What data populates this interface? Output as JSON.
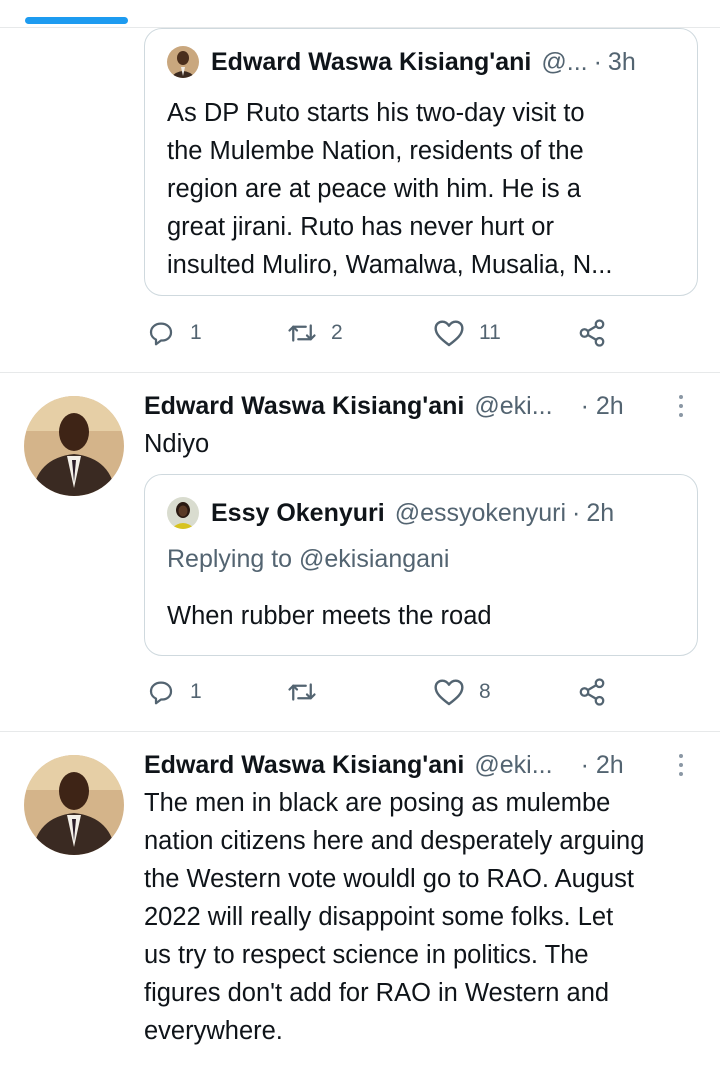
{
  "colors": {
    "accent": "#1d9bf0",
    "text": "#0f1419",
    "muted": "#536471",
    "border": "#cfd9de"
  },
  "first_quote": {
    "name": "Edward Waswa Kisiang'ani",
    "handle": "@...",
    "separator": "·",
    "time": "3h",
    "text_lines": [
      "As DP Ruto starts his two-day visit to",
      "the Mulembe Nation, residents of the",
      "region are at peace with him. He is a",
      "great jirani. Ruto has never hurt or",
      "insulted Muliro, Wamalwa, Musalia, N..."
    ],
    "actions": {
      "reply_count": "1",
      "retweet_count": "2",
      "like_count": "11"
    }
  },
  "tweets": [
    {
      "name": "Edward Waswa Kisiang'ani",
      "handle": "@eki...",
      "time": "· 2h",
      "text": "Ndiyo",
      "quote": {
        "name": "Essy Okenyuri",
        "handle": "@essyokenyuri",
        "separator": "·",
        "time": "2h",
        "replying_to": "Replying to @ekisiangani",
        "text": "When rubber meets the road"
      },
      "actions": {
        "reply_count": "1",
        "retweet_count": "",
        "like_count": "8"
      }
    },
    {
      "name": "Edward Waswa Kisiang'ani",
      "handle": "@eki...",
      "time": "· 2h",
      "text_lines": [
        "The men in black are posing as mulembe",
        "nation citizens here and desperately arguing",
        "the Western vote wouldl go to RAO. August",
        "2022 will really disappoint  some folks. Let",
        "us try to respect science in politics. The",
        "figures don't add for RAO in Western and",
        "everywhere."
      ]
    }
  ],
  "icons": [
    "reply-icon",
    "retweet-icon",
    "like-icon",
    "share-icon",
    "more-icon"
  ]
}
